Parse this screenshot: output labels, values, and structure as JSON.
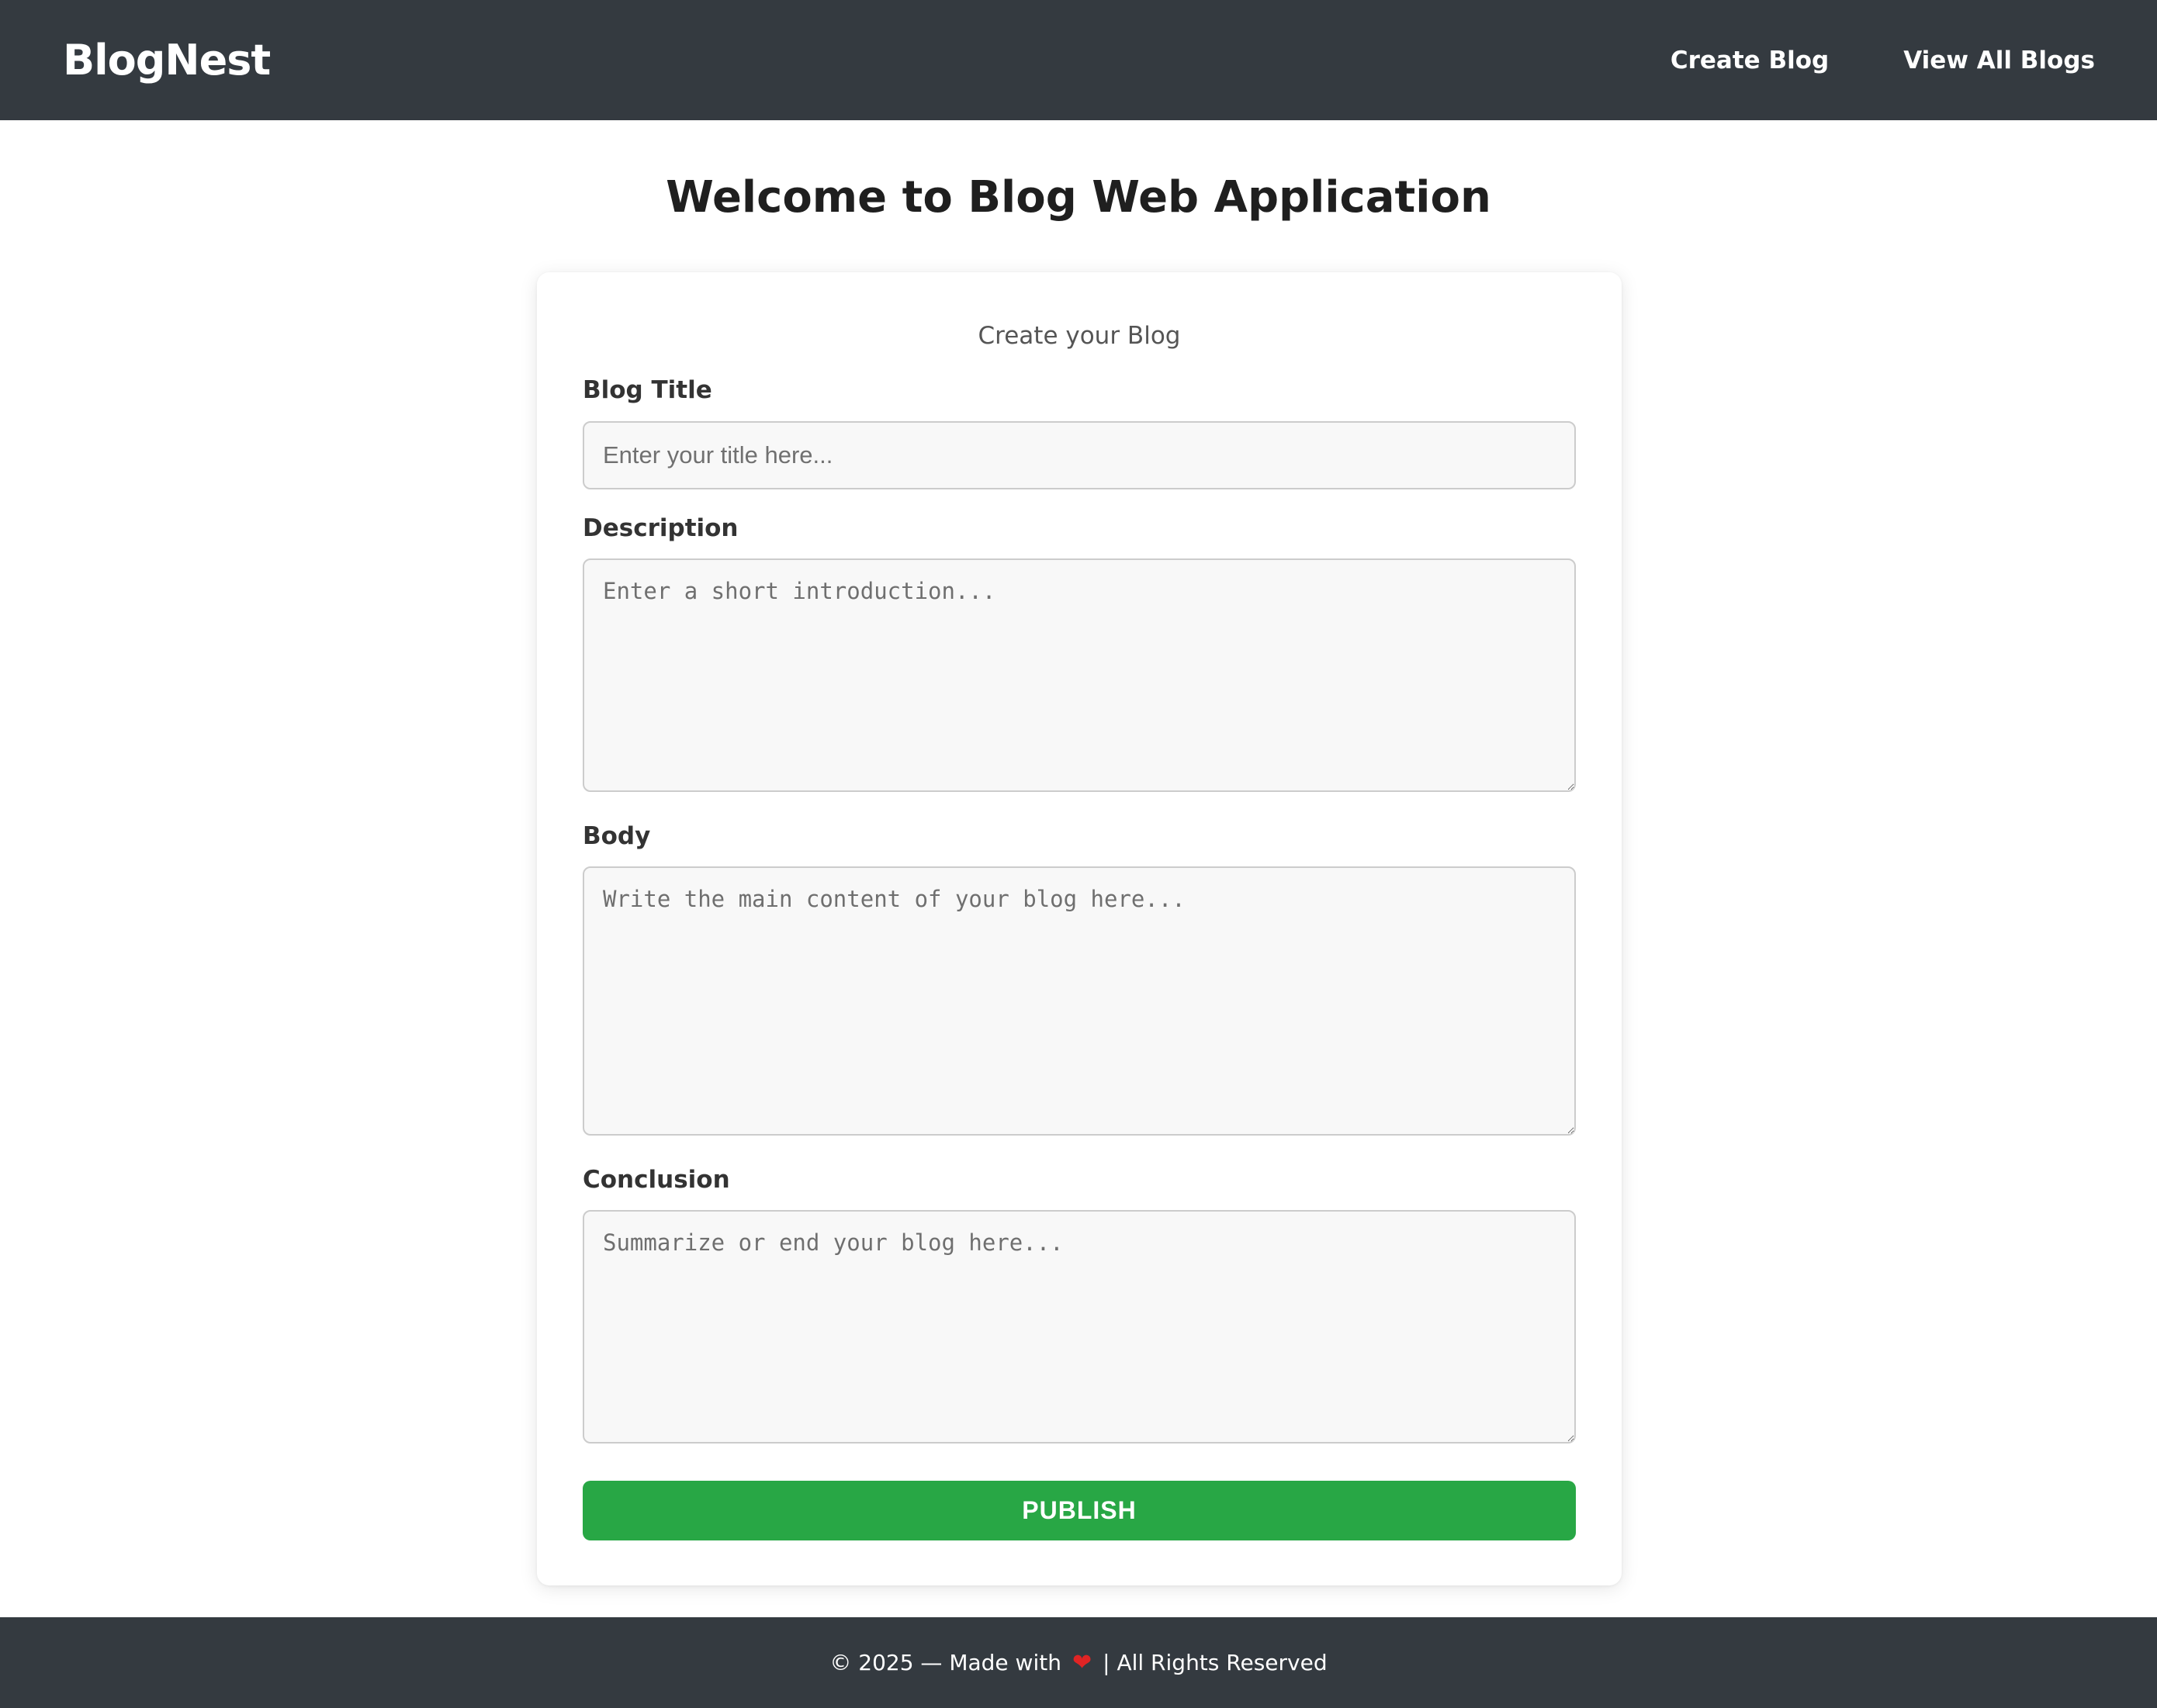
{
  "header": {
    "brand": "BlogNest",
    "nav": [
      {
        "label": "Create Blog"
      },
      {
        "label": "View All Blogs"
      }
    ]
  },
  "main": {
    "title": "Welcome to Blog Web Application",
    "form": {
      "subtitle": "Create your Blog",
      "fields": {
        "title": {
          "label": "Blog Title",
          "placeholder": "Enter your title here..."
        },
        "description": {
          "label": "Description",
          "placeholder": "Enter a short introduction..."
        },
        "body": {
          "label": "Body",
          "placeholder": "Write the main content of your blog here..."
        },
        "conclusion": {
          "label": "Conclusion",
          "placeholder": "Summarize or end your blog here..."
        }
      },
      "publish_label": "PUBLISH"
    }
  },
  "footer": {
    "prefix": "© 2025 — Made with",
    "heart_icon": "heart-icon",
    "suffix": "| All Rights Reserved"
  },
  "colors": {
    "navbar": "#343a40",
    "publish_button": "#28a745",
    "heart": "#e02424"
  }
}
